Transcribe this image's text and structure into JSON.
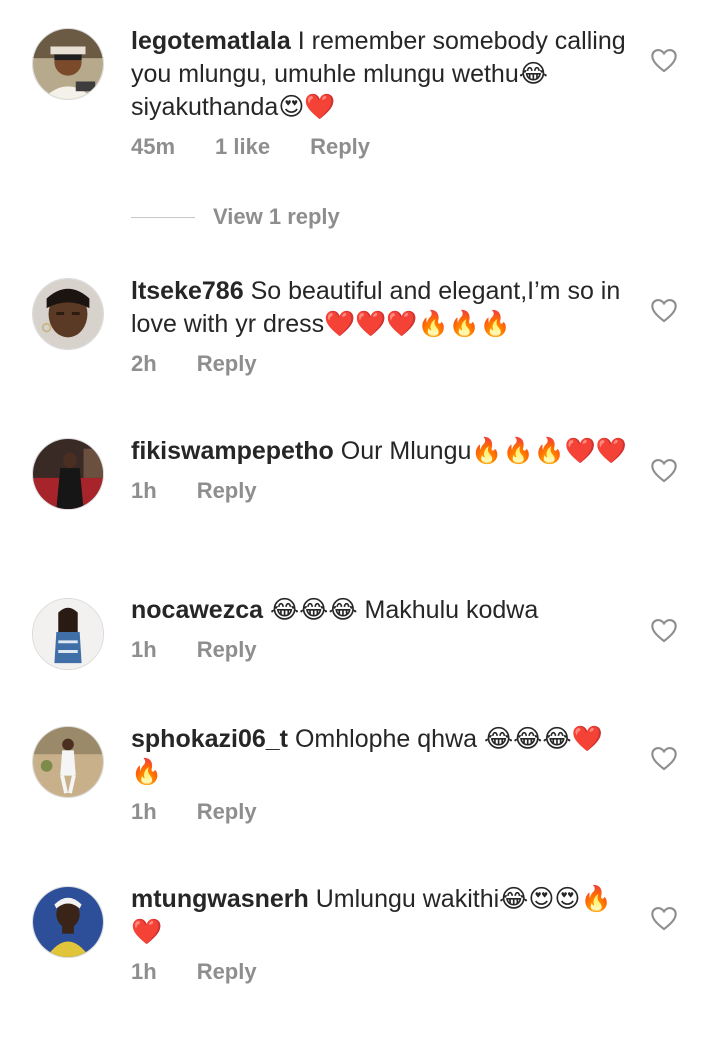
{
  "comments": [
    {
      "username": "legotematlala",
      "text": "I remember somebody calling you mlungu, umuhle mlungu wethu😂siyakuthanda😍❤️",
      "time": "45m",
      "likes": "1 like",
      "reply": "Reply",
      "view_replies": "View 1 reply"
    },
    {
      "username": "ltseke786",
      "text": "So beautiful and elegant,I’m so in love with yr dress❤️❤️❤️🔥🔥🔥",
      "time": "2h",
      "reply": "Reply"
    },
    {
      "username": "fikiswampepetho",
      "text": "Our Mlungu🔥🔥🔥❤️❤️",
      "time": "1h",
      "reply": "Reply"
    },
    {
      "username": "nocawezca",
      "text": "😂😂😂 Makhulu kodwa",
      "time": "1h",
      "reply": "Reply"
    },
    {
      "username": "sphokazi06_t",
      "text": "Omhlophe qhwa 😂😂😂❤️🔥",
      "time": "1h",
      "reply": "Reply"
    },
    {
      "username": "mtungwasnerh",
      "text": "Umlungu wakithi😂😍😍🔥❤️",
      "time": "1h",
      "reply": "Reply"
    }
  ],
  "icons": {
    "like": "heart-outline-icon",
    "avatar_border": "#dbdbdb"
  },
  "colors": {
    "text": "#262626",
    "muted": "#8e8e8e"
  }
}
